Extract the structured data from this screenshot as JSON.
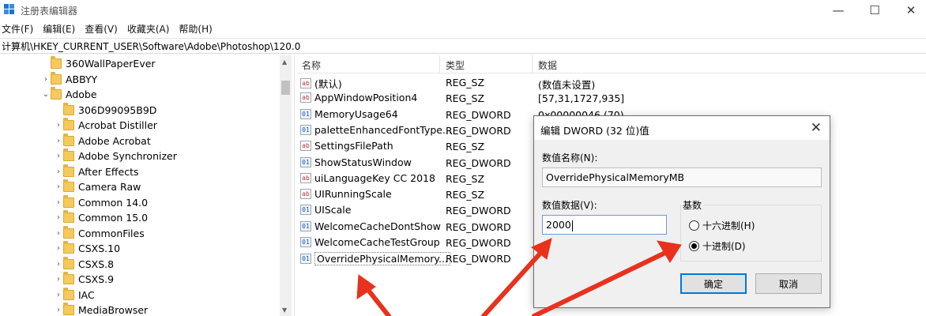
{
  "window": {
    "title": "注册表编辑器",
    "minimize": "—",
    "maximize": "☐",
    "close": "✕"
  },
  "menu": [
    "文件(F)",
    "编辑(E)",
    "查看(V)",
    "收藏夹(A)",
    "帮助(H)"
  ],
  "address": "计算机\\HKEY_CURRENT_USER\\Software\\Adobe\\Photoshop\\120.0",
  "tree": [
    {
      "label": "360WallPaperEver",
      "arrow": ""
    },
    {
      "label": "ABBYY",
      "arrow": "›"
    },
    {
      "label": "Adobe",
      "arrow": "⌄"
    },
    {
      "label": "306D99095B9D",
      "arrow": ""
    },
    {
      "label": "Acrobat Distiller",
      "arrow": "›"
    },
    {
      "label": "Adobe Acrobat",
      "arrow": "›"
    },
    {
      "label": "Adobe Synchronizer",
      "arrow": "›"
    },
    {
      "label": "After Effects",
      "arrow": "›"
    },
    {
      "label": "Camera Raw",
      "arrow": "›"
    },
    {
      "label": "Common 14.0",
      "arrow": "›"
    },
    {
      "label": "Common 15.0",
      "arrow": "›"
    },
    {
      "label": "CommonFiles",
      "arrow": "›"
    },
    {
      "label": "CSXS.10",
      "arrow": "›"
    },
    {
      "label": "CSXS.8",
      "arrow": "›"
    },
    {
      "label": "CSXS.9",
      "arrow": "›"
    },
    {
      "label": "IAC",
      "arrow": "›"
    },
    {
      "label": "MediaBrowser",
      "arrow": "›"
    }
  ],
  "list": {
    "headers": {
      "name": "名称",
      "type": "类型",
      "data": "数据"
    },
    "rows": [
      {
        "icon": "sz",
        "icon_label": "ab",
        "name": "(默认)",
        "type": "REG_SZ",
        "data": "(数值未设置)"
      },
      {
        "icon": "sz",
        "icon_label": "ab",
        "name": "AppWindowPosition4",
        "type": "REG_SZ",
        "data": "[57,31,1727,935]"
      },
      {
        "icon": "dw",
        "icon_label": "01",
        "name": "MemoryUsage64",
        "type": "REG_DWORD",
        "data": "0x00000046 (70)"
      },
      {
        "icon": "dw",
        "icon_label": "01",
        "name": "paletteEnhancedFontType...",
        "type": "REG_DWORD",
        "data": ""
      },
      {
        "icon": "sz",
        "icon_label": "ab",
        "name": "SettingsFilePath",
        "type": "REG_SZ",
        "data": ""
      },
      {
        "icon": "dw",
        "icon_label": "01",
        "name": "ShowStatusWindow",
        "type": "REG_DWORD",
        "data": ""
      },
      {
        "icon": "sz",
        "icon_label": "ab",
        "name": "uiLanguageKey CC 2018",
        "type": "REG_SZ",
        "data": ""
      },
      {
        "icon": "sz",
        "icon_label": "ab",
        "name": "UIRunningScale",
        "type": "REG_SZ",
        "data": ""
      },
      {
        "icon": "dw",
        "icon_label": "01",
        "name": "UIScale",
        "type": "REG_DWORD",
        "data": ""
      },
      {
        "icon": "dw",
        "icon_label": "01",
        "name": "WelcomeCacheDontShow",
        "type": "REG_DWORD",
        "data": ""
      },
      {
        "icon": "dw",
        "icon_label": "01",
        "name": "WelcomeCacheTestGroup",
        "type": "REG_DWORD",
        "data": ""
      },
      {
        "icon": "dw",
        "icon_label": "01",
        "name": "OverridePhysicalMemory...",
        "type": "REG_DWORD",
        "data": ""
      }
    ]
  },
  "dialog": {
    "title": "编辑 DWORD (32 位)值",
    "close": "✕",
    "name_label": "数值名称(N):",
    "name_value": "OverridePhysicalMemoryMB",
    "data_label": "数值数据(V):",
    "data_value": "2000",
    "base_label": "基数",
    "radio_hex": "十六进制(H)",
    "radio_dec": "十进制(D)",
    "ok": "确定",
    "cancel": "取消"
  },
  "colors": {
    "arrow": "#e8321e",
    "accent": "#0078d7"
  }
}
